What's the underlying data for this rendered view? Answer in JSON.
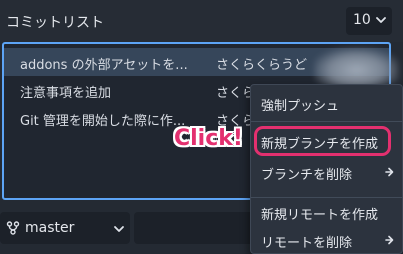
{
  "header": {
    "title": "コミットリスト",
    "count_select": {
      "value": "10",
      "icon": "chevron-down-icon"
    }
  },
  "commits": [
    {
      "message": "addons の外部アセットを...",
      "author": "さくらくらうど"
    },
    {
      "message": "注意事項を追加",
      "author": "さくらくらうど"
    },
    {
      "message": "Git 管理を開始した際に作...",
      "author": "さくら"
    }
  ],
  "branch_select": {
    "value": "master",
    "icon": "git-branch-icon"
  },
  "context_menu": {
    "items": [
      {
        "label": "強制プッシュ",
        "submenu": false
      },
      {
        "label": "新規ブランチを作成",
        "submenu": false,
        "highlighted": true
      },
      {
        "label": "ブランチを削除",
        "submenu": true
      },
      {
        "label": "新規リモートを作成",
        "submenu": false
      },
      {
        "label": "リモートを削除",
        "submenu": true
      }
    ]
  },
  "annotation": {
    "callout": "Click!",
    "color": "#e3306f"
  },
  "colors": {
    "accent": "#5da4f5",
    "selected_row": "#36465a",
    "background": "#242a33"
  }
}
